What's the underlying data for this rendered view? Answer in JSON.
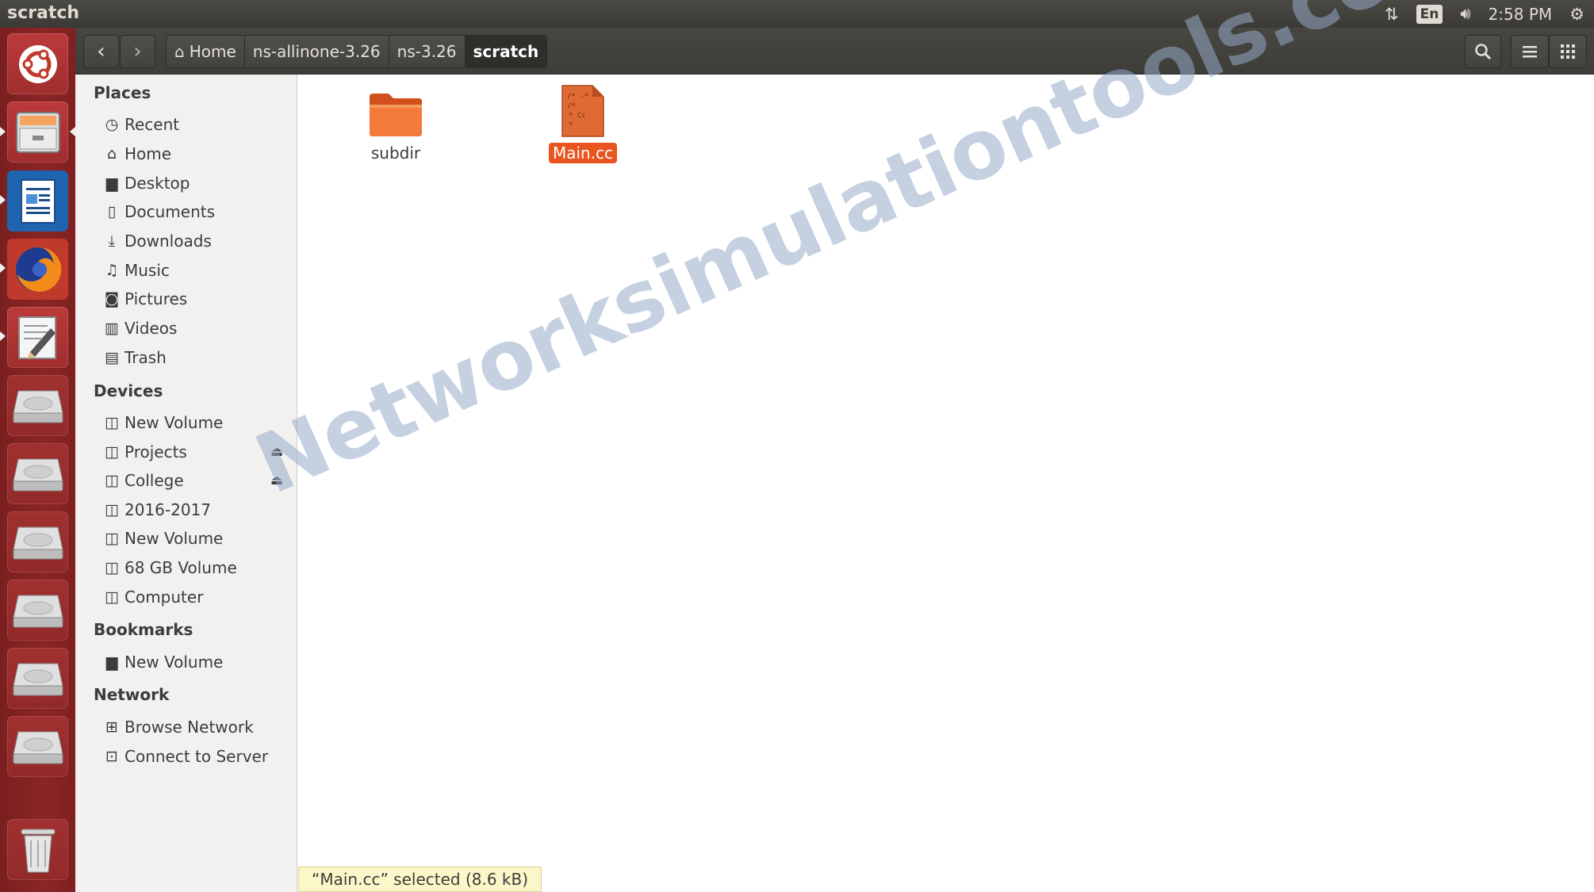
{
  "window": {
    "title": "scratch"
  },
  "panel": {
    "lang": "En",
    "clock": "2:58 PM"
  },
  "headerbar": {
    "breadcrumbs": [
      "Home",
      "ns-allinone-3.26",
      "ns-3.26",
      "scratch"
    ]
  },
  "sidebar": {
    "places_title": "Places",
    "places": [
      "Recent",
      "Home",
      "Desktop",
      "Documents",
      "Downloads",
      "Music",
      "Pictures",
      "Videos",
      "Trash"
    ],
    "devices_title": "Devices",
    "devices": [
      "New Volume",
      "Projects",
      "College",
      "2016-2017",
      "New Volume",
      "68 GB Volume",
      "Computer"
    ],
    "bookmarks_title": "Bookmarks",
    "bookmarks": [
      "New Volume"
    ],
    "network_title": "Network",
    "network": [
      "Browse Network",
      "Connect to Server"
    ]
  },
  "files": [
    {
      "name": "subdir",
      "kind": "folder",
      "selected": false
    },
    {
      "name": "Main.cc",
      "kind": "cpp-source",
      "selected": true
    }
  ],
  "status": {
    "text": "“Main.cc” selected  (8.6 kB)"
  },
  "watermark": {
    "text": "Networksimulationtools.com"
  },
  "colors": {
    "accent": "#e95420",
    "launcher": "#8c2525",
    "panel": "#3b3a36"
  }
}
